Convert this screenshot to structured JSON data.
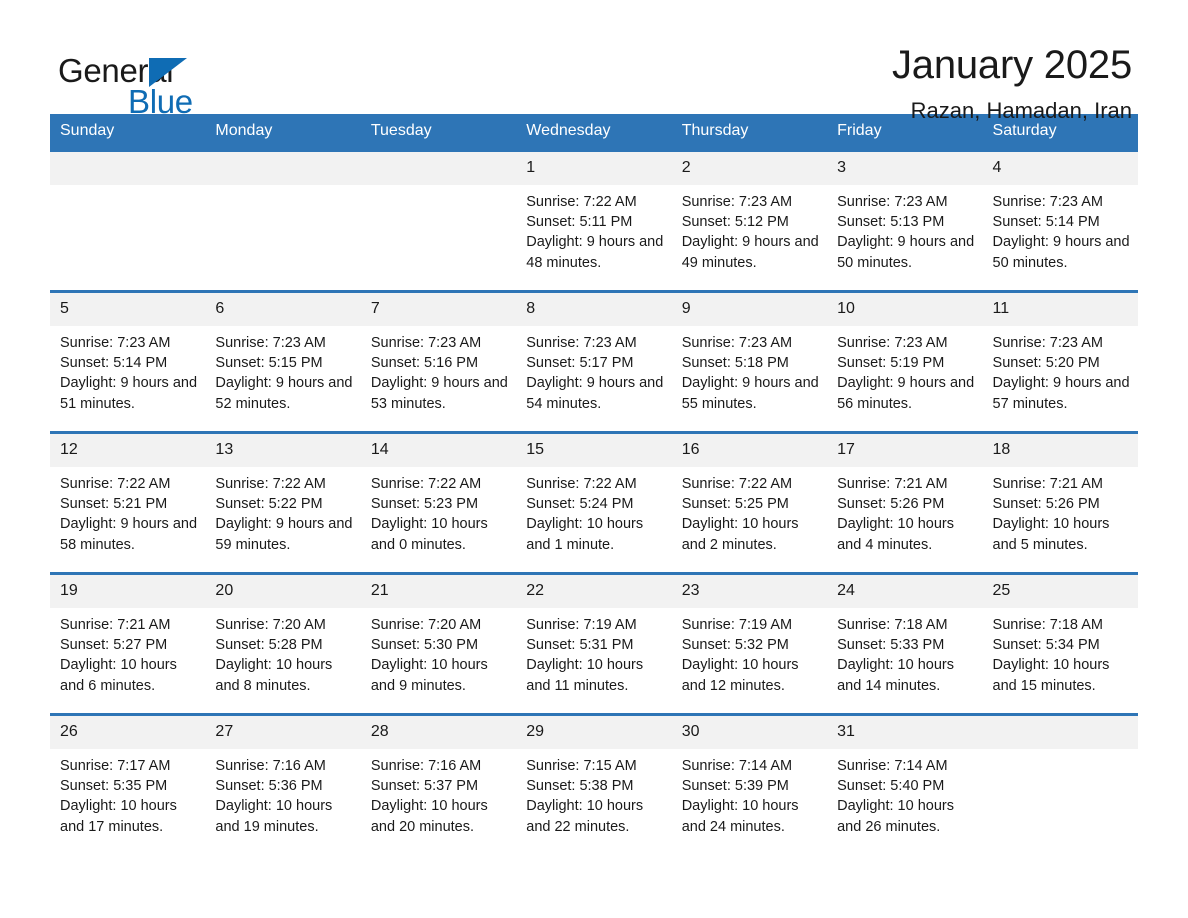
{
  "brand": {
    "name_part1": "General",
    "name_part2": "Blue",
    "triangle_color": "#0f6cb4"
  },
  "header": {
    "title": "January 2025",
    "subtitle": "Razan, Hamadan, Iran"
  },
  "colors": {
    "header_blue": "#2e75b6",
    "daynum_band": "#f2f2f2",
    "text": "#1a1a1a"
  },
  "weekday_headers": [
    "Sunday",
    "Monday",
    "Tuesday",
    "Wednesday",
    "Thursday",
    "Friday",
    "Saturday"
  ],
  "weeks": [
    {
      "days": [
        {
          "num": "",
          "blank": true
        },
        {
          "num": "",
          "blank": true
        },
        {
          "num": "",
          "blank": true
        },
        {
          "num": "1",
          "sunrise": "Sunrise: 7:22 AM",
          "sunset": "Sunset: 5:11 PM",
          "daylight": "Daylight: 9 hours and 48 minutes."
        },
        {
          "num": "2",
          "sunrise": "Sunrise: 7:23 AM",
          "sunset": "Sunset: 5:12 PM",
          "daylight": "Daylight: 9 hours and 49 minutes."
        },
        {
          "num": "3",
          "sunrise": "Sunrise: 7:23 AM",
          "sunset": "Sunset: 5:13 PM",
          "daylight": "Daylight: 9 hours and 50 minutes."
        },
        {
          "num": "4",
          "sunrise": "Sunrise: 7:23 AM",
          "sunset": "Sunset: 5:14 PM",
          "daylight": "Daylight: 9 hours and 50 minutes."
        }
      ]
    },
    {
      "days": [
        {
          "num": "5",
          "sunrise": "Sunrise: 7:23 AM",
          "sunset": "Sunset: 5:14 PM",
          "daylight": "Daylight: 9 hours and 51 minutes."
        },
        {
          "num": "6",
          "sunrise": "Sunrise: 7:23 AM",
          "sunset": "Sunset: 5:15 PM",
          "daylight": "Daylight: 9 hours and 52 minutes."
        },
        {
          "num": "7",
          "sunrise": "Sunrise: 7:23 AM",
          "sunset": "Sunset: 5:16 PM",
          "daylight": "Daylight: 9 hours and 53 minutes."
        },
        {
          "num": "8",
          "sunrise": "Sunrise: 7:23 AM",
          "sunset": "Sunset: 5:17 PM",
          "daylight": "Daylight: 9 hours and 54 minutes."
        },
        {
          "num": "9",
          "sunrise": "Sunrise: 7:23 AM",
          "sunset": "Sunset: 5:18 PM",
          "daylight": "Daylight: 9 hours and 55 minutes."
        },
        {
          "num": "10",
          "sunrise": "Sunrise: 7:23 AM",
          "sunset": "Sunset: 5:19 PM",
          "daylight": "Daylight: 9 hours and 56 minutes."
        },
        {
          "num": "11",
          "sunrise": "Sunrise: 7:23 AM",
          "sunset": "Sunset: 5:20 PM",
          "daylight": "Daylight: 9 hours and 57 minutes."
        }
      ]
    },
    {
      "days": [
        {
          "num": "12",
          "sunrise": "Sunrise: 7:22 AM",
          "sunset": "Sunset: 5:21 PM",
          "daylight": "Daylight: 9 hours and 58 minutes."
        },
        {
          "num": "13",
          "sunrise": "Sunrise: 7:22 AM",
          "sunset": "Sunset: 5:22 PM",
          "daylight": "Daylight: 9 hours and 59 minutes."
        },
        {
          "num": "14",
          "sunrise": "Sunrise: 7:22 AM",
          "sunset": "Sunset: 5:23 PM",
          "daylight": "Daylight: 10 hours and 0 minutes."
        },
        {
          "num": "15",
          "sunrise": "Sunrise: 7:22 AM",
          "sunset": "Sunset: 5:24 PM",
          "daylight": "Daylight: 10 hours and 1 minute."
        },
        {
          "num": "16",
          "sunrise": "Sunrise: 7:22 AM",
          "sunset": "Sunset: 5:25 PM",
          "daylight": "Daylight: 10 hours and 2 minutes."
        },
        {
          "num": "17",
          "sunrise": "Sunrise: 7:21 AM",
          "sunset": "Sunset: 5:26 PM",
          "daylight": "Daylight: 10 hours and 4 minutes."
        },
        {
          "num": "18",
          "sunrise": "Sunrise: 7:21 AM",
          "sunset": "Sunset: 5:26 PM",
          "daylight": "Daylight: 10 hours and 5 minutes."
        }
      ]
    },
    {
      "days": [
        {
          "num": "19",
          "sunrise": "Sunrise: 7:21 AM",
          "sunset": "Sunset: 5:27 PM",
          "daylight": "Daylight: 10 hours and 6 minutes."
        },
        {
          "num": "20",
          "sunrise": "Sunrise: 7:20 AM",
          "sunset": "Sunset: 5:28 PM",
          "daylight": "Daylight: 10 hours and 8 minutes."
        },
        {
          "num": "21",
          "sunrise": "Sunrise: 7:20 AM",
          "sunset": "Sunset: 5:30 PM",
          "daylight": "Daylight: 10 hours and 9 minutes."
        },
        {
          "num": "22",
          "sunrise": "Sunrise: 7:19 AM",
          "sunset": "Sunset: 5:31 PM",
          "daylight": "Daylight: 10 hours and 11 minutes."
        },
        {
          "num": "23",
          "sunrise": "Sunrise: 7:19 AM",
          "sunset": "Sunset: 5:32 PM",
          "daylight": "Daylight: 10 hours and 12 minutes."
        },
        {
          "num": "24",
          "sunrise": "Sunrise: 7:18 AM",
          "sunset": "Sunset: 5:33 PM",
          "daylight": "Daylight: 10 hours and 14 minutes."
        },
        {
          "num": "25",
          "sunrise": "Sunrise: 7:18 AM",
          "sunset": "Sunset: 5:34 PM",
          "daylight": "Daylight: 10 hours and 15 minutes."
        }
      ]
    },
    {
      "days": [
        {
          "num": "26",
          "sunrise": "Sunrise: 7:17 AM",
          "sunset": "Sunset: 5:35 PM",
          "daylight": "Daylight: 10 hours and 17 minutes."
        },
        {
          "num": "27",
          "sunrise": "Sunrise: 7:16 AM",
          "sunset": "Sunset: 5:36 PM",
          "daylight": "Daylight: 10 hours and 19 minutes."
        },
        {
          "num": "28",
          "sunrise": "Sunrise: 7:16 AM",
          "sunset": "Sunset: 5:37 PM",
          "daylight": "Daylight: 10 hours and 20 minutes."
        },
        {
          "num": "29",
          "sunrise": "Sunrise: 7:15 AM",
          "sunset": "Sunset: 5:38 PM",
          "daylight": "Daylight: 10 hours and 22 minutes."
        },
        {
          "num": "30",
          "sunrise": "Sunrise: 7:14 AM",
          "sunset": "Sunset: 5:39 PM",
          "daylight": "Daylight: 10 hours and 24 minutes."
        },
        {
          "num": "31",
          "sunrise": "Sunrise: 7:14 AM",
          "sunset": "Sunset: 5:40 PM",
          "daylight": "Daylight: 10 hours and 26 minutes."
        },
        {
          "num": "",
          "blank": true
        }
      ]
    }
  ]
}
